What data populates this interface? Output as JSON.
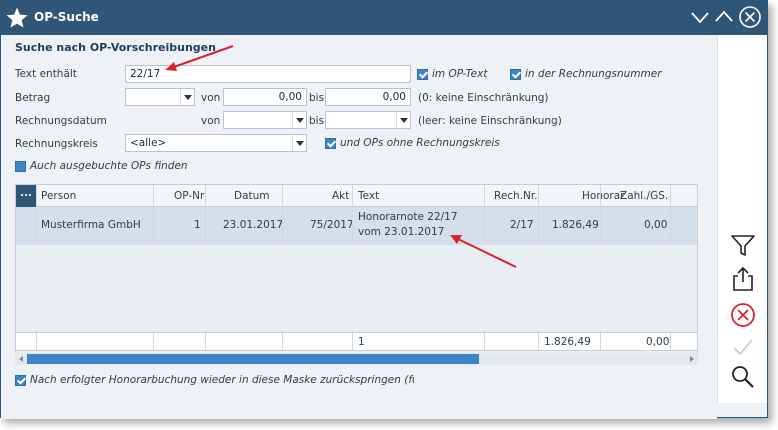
{
  "window": {
    "title": "OP-Suche"
  },
  "form": {
    "section_title": "Suche nach OP-Vorschreibungen",
    "text_label": "Text enthält",
    "text_value": "22/17",
    "chk_op_text": "im OP-Text",
    "chk_rechnungsnummer": "in der Rechnungsnummer",
    "betrag_label": "Betrag",
    "von": "von",
    "bis": "bis",
    "betrag_von": "0,00",
    "betrag_bis": "0,00",
    "betrag_hint": "(0: keine Einschränkung)",
    "rechnungsdatum_label": "Rechnungsdatum",
    "datum_hint": "(leer: keine Einschränkung)",
    "rechnungskreis_label": "Rechnungskreis",
    "rechnungskreis_value": "<alle>",
    "chk_ohne_rechnungskreis": "und OPs ohne Rechnungskreis",
    "chk_ausgebucht": "Auch ausgebuchte OPs finden"
  },
  "table": {
    "corner": "...",
    "columns": [
      "Person",
      "OP-Nr",
      "Datum",
      "Akt",
      "Text",
      "Rech.Nr.",
      "Honorar",
      "Zahl./GS."
    ],
    "row": {
      "person": "Musterfirma GmbH",
      "op_nr": "1",
      "datum": "23.01.2017",
      "akt": "75/2017",
      "text_line1": "Honorarnote 22/17",
      "text_line2": "vom 23.01.2017",
      "rech_nr": "2/17",
      "honorar": "1.826,49",
      "zahl_gs": "0,00"
    },
    "summary": {
      "count": "1",
      "honorar": "1.826,49",
      "zahl_gs": "0,00"
    }
  },
  "footer": {
    "chk_return": "Nach erfolgter Honorarbuchung wieder in diese Maske zurückspringen (für weitere"
  },
  "colors": {
    "titlebar": "#2f5677",
    "accent": "#3d85c6",
    "arrow": "#d9232e"
  },
  "icons": [
    "star-icon",
    "minimize-icon",
    "maximize-icon",
    "close-icon",
    "filter-icon",
    "export-icon",
    "cancel-icon",
    "confirm-icon",
    "search-icon"
  ]
}
